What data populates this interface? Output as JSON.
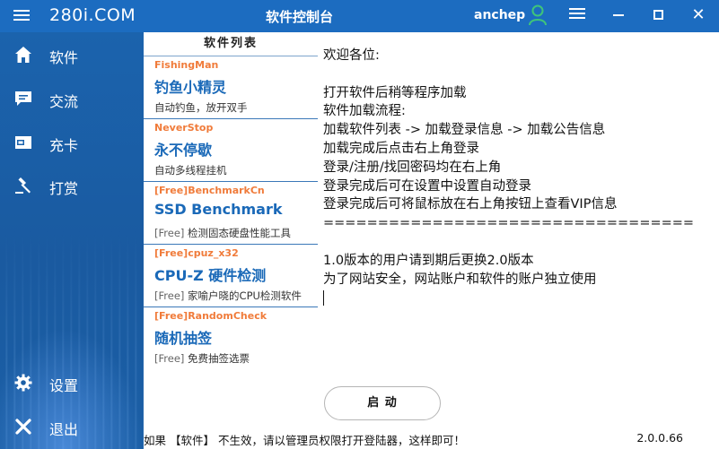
{
  "app": {
    "brand": "280i.COM",
    "title": "软件控制台",
    "username": "anchep"
  },
  "sidebar": {
    "items": [
      {
        "label": "软件",
        "icon": "home-icon"
      },
      {
        "label": "交流",
        "icon": "chat-icon"
      },
      {
        "label": "充卡",
        "icon": "card-icon"
      },
      {
        "label": "打赏",
        "icon": "hammer-icon"
      },
      {
        "label": "设置",
        "icon": "gear-icon"
      },
      {
        "label": "退出",
        "icon": "close-icon"
      }
    ]
  },
  "software_list": {
    "title": "软件列表",
    "items": [
      {
        "tag": "FishingMan",
        "name": "钓鱼小精灵",
        "free": "",
        "desc": "自动钓鱼，放开双手"
      },
      {
        "tag": "NeverStop",
        "name": "永不停歇",
        "free": "",
        "desc": "自动多线程挂机"
      },
      {
        "tag": "[Free]BenchmarkCn",
        "name": "SSD Benchmark",
        "free": "[Free]",
        "desc": " 检测固态硬盘性能工具"
      },
      {
        "tag": "[Free]cpuz_x32",
        "name": "CPU-Z 硬件检测",
        "free": "[Free]",
        "desc": " 家喻户晓的CPU检测软件"
      },
      {
        "tag": "[Free]RandomCheck",
        "name": "随机抽签",
        "free": "[Free]",
        "desc": " 免费抽签选票"
      }
    ]
  },
  "notice": {
    "lines": [
      "欢迎各位:",
      "",
      "打开软件后稍等程序加载",
      "软件加载流程:",
      "加载软件列表 -> 加载登录信息 -> 加载公告信息",
      "加载完成后点击右上角登录",
      "登录/注册/找回密码均在右上角",
      "登录完成后可在设置中设置自动登录",
      "登录完成后可将鼠标放在右上角按钮上查看VIP信息",
      "==================================",
      "",
      "1.0版本的用户请到期后更换2.0版本",
      "为了网站安全，网站账户和软件的账户独立使用"
    ]
  },
  "actions": {
    "start_label": "启 动"
  },
  "status": {
    "hint": "如果 【软件】 不生效，请以管理员权限打开登陆器，这样即可！",
    "version": "2.0.0.66"
  },
  "colors": {
    "titlebar": "#1c6cc0",
    "sidebar": "#1a5aa0",
    "tag_orange": "#f07b3a",
    "software_name_blue": "#1a69b8",
    "user_icon_green": "#3fc47a"
  }
}
